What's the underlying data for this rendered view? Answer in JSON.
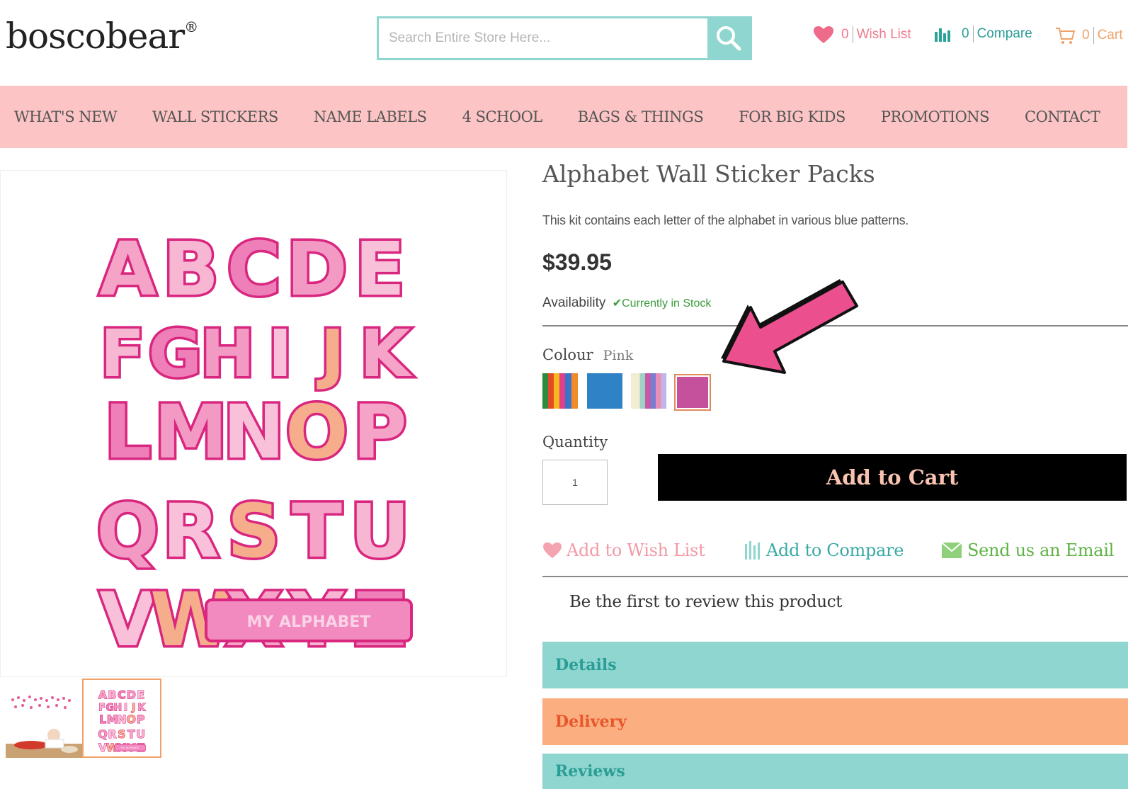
{
  "header": {
    "logo": "boscobear",
    "logo_mark": "®",
    "search_placeholder": "Search Entire Store Here...",
    "wishlist": {
      "count": "0",
      "label": "Wish List"
    },
    "compare": {
      "count": "0",
      "label": "Compare"
    },
    "cart": {
      "count": "0",
      "label": "Cart"
    }
  },
  "nav": {
    "items": [
      "WHAT'S NEW",
      "WALL STICKERS",
      "NAME LABELS",
      "4 SCHOOL",
      "BAGS & THINGS",
      "FOR BIG KIDS",
      "PROMOTIONS",
      "CONTACT"
    ]
  },
  "gallery": {
    "letter_rows": [
      [
        "A",
        "B",
        "C",
        "D",
        "E"
      ],
      [
        "F",
        "G",
        "H",
        "I",
        "J",
        "K"
      ],
      [
        "L",
        "M",
        "N",
        "O",
        "P"
      ],
      [
        "Q",
        "R",
        "S",
        "T",
        "U"
      ],
      [
        "V",
        "W",
        "X",
        "Y",
        "Z"
      ]
    ],
    "banner_text": "MY ALPHABET",
    "thumbnails": [
      "lifestyle-photo",
      "alphabet-sheet"
    ]
  },
  "product": {
    "title": "Alphabet Wall Sticker Packs",
    "description": "This kit contains each letter of the alphabet in various blue patterns.",
    "price": "$39.95",
    "availability_label": "Availability",
    "availability_status": "Currently in Stock",
    "colour_label": "Colour",
    "colour_selected": "Pink",
    "swatches": [
      "multicolour-stripes",
      "blue",
      "pastel-stripes",
      "pink"
    ],
    "quantity_label": "Quantity",
    "quantity_value": "1",
    "add_to_cart": "Add to Cart",
    "actions": {
      "wishlist": "Add to Wish List",
      "compare": "Add to Compare",
      "email": "Send us an Email"
    },
    "review_prompt": "Be the first to review this product",
    "panels": [
      "Details",
      "Delivery",
      "Reviews"
    ]
  },
  "colors": {
    "nav_bg": "#fcc4c4",
    "teal": "#8fd6d0",
    "orange": "#fbae7f",
    "pink_accent": "#ef6b8a",
    "pink_letters": "#e0338a",
    "arrow_pink": "#ec4f8e",
    "green_email": "#6cbf4a"
  }
}
